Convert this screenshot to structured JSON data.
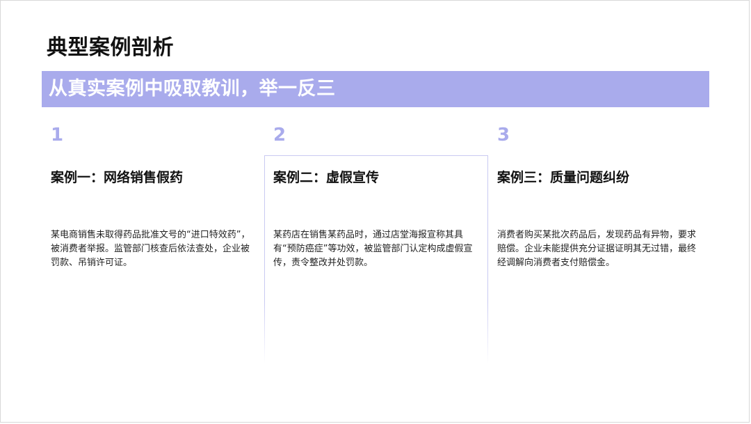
{
  "slide": {
    "title": "典型案例剖析",
    "banner": "从真实案例中吸取教训，举一反三",
    "accent_color": "#a9abec"
  },
  "cases": [
    {
      "number": "1",
      "title": "案例一：网络销售假药",
      "description": "某电商销售未取得药品批准文号的“进口特效药”，被消费者举报。监管部门核查后依法查处，企业被罚款、吊销许可证。"
    },
    {
      "number": "2",
      "title": "案例二：虚假宣传",
      "description": "某药店在销售某药品时，通过店堂海报宣称其具有“预防癌症”等功效，被监管部门认定构成虚假宣传，责令整改并处罚款。"
    },
    {
      "number": "3",
      "title": "案例三：质量问题纠纷",
      "description": "消费者购买某批次药品后，发现药品有异物，要求赔偿。企业未能提供充分证据证明其无过错，最终经调解向消费者支付赔偿金。"
    }
  ]
}
